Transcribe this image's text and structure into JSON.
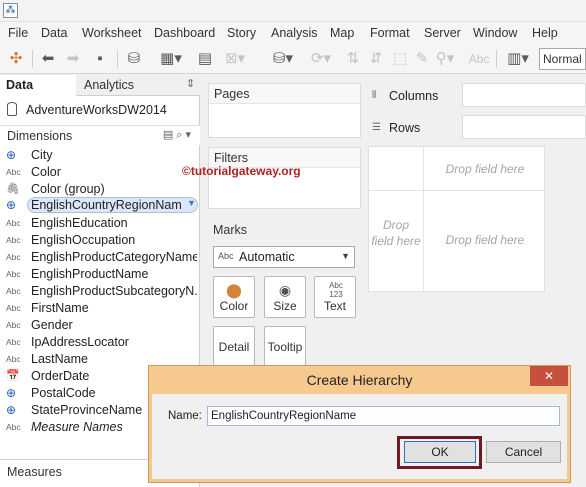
{
  "menu": [
    "File",
    "Data",
    "Worksheet",
    "Dashboard",
    "Story",
    "Analysis",
    "Map",
    "Format",
    "Server",
    "Window",
    "Help"
  ],
  "toolbar": {
    "text_label": "Abc",
    "show_me_value": "Normal"
  },
  "data_pane": {
    "tab_data": "Data",
    "tab_analytics": "Analytics",
    "datasource": "AdventureWorksDW2014",
    "dimensions_header": "Dimensions",
    "fields": [
      {
        "icon": "globe",
        "label": "City"
      },
      {
        "icon": "Abc",
        "label": "Color"
      },
      {
        "icon": "clip",
        "label": "Color (group)"
      },
      {
        "icon": "globe",
        "label": "EnglishCountryRegionName"
      },
      {
        "icon": "Abc",
        "label": "EnglishEducation"
      },
      {
        "icon": "Abc",
        "label": "EnglishOccupation"
      },
      {
        "icon": "Abc",
        "label": "EnglishProductCategoryName"
      },
      {
        "icon": "Abc",
        "label": "EnglishProductName"
      },
      {
        "icon": "Abc",
        "label": "EnglishProductSubcategoryN..."
      },
      {
        "icon": "Abc",
        "label": "FirstName"
      },
      {
        "icon": "Abc",
        "label": "Gender"
      },
      {
        "icon": "Abc",
        "label": "IpAddressLocator"
      },
      {
        "icon": "Abc",
        "label": "LastName"
      },
      {
        "icon": "cal",
        "label": "OrderDate"
      },
      {
        "icon": "globe",
        "label": "PostalCode"
      },
      {
        "icon": "globe",
        "label": "StateProvinceName"
      },
      {
        "icon": "Abc",
        "label": "Measure Names"
      }
    ],
    "measures_header": "Measures"
  },
  "cards": {
    "pages": "Pages",
    "filters": "Filters",
    "marks": "Marks",
    "marks_type_icon": "Abc",
    "marks_type": "Automatic",
    "mark_buttons": {
      "color": "Color",
      "size": "Size",
      "text": "Text",
      "text_icon": "Abc 123",
      "detail": "Detail",
      "tooltip": "Tooltip"
    }
  },
  "shelves": {
    "columns": "Columns",
    "rows": "Rows"
  },
  "canvas": {
    "drop_top": "Drop field here",
    "drop_left": "Drop field here",
    "drop_center": "Drop field here"
  },
  "watermark": "©tutorialgateway.org",
  "dialog": {
    "title": "Create Hierarchy",
    "name_label": "Name:",
    "name_value": "EnglishCountryRegionName",
    "ok_label": "OK",
    "cancel_label": "Cancel",
    "close_glyph": "✕"
  },
  "colors": {
    "dialog_titlebar": "#f6c98e",
    "annotation": "#6e1a24",
    "watermark": "#b22222",
    "selected_field": "#dbe7f6"
  }
}
